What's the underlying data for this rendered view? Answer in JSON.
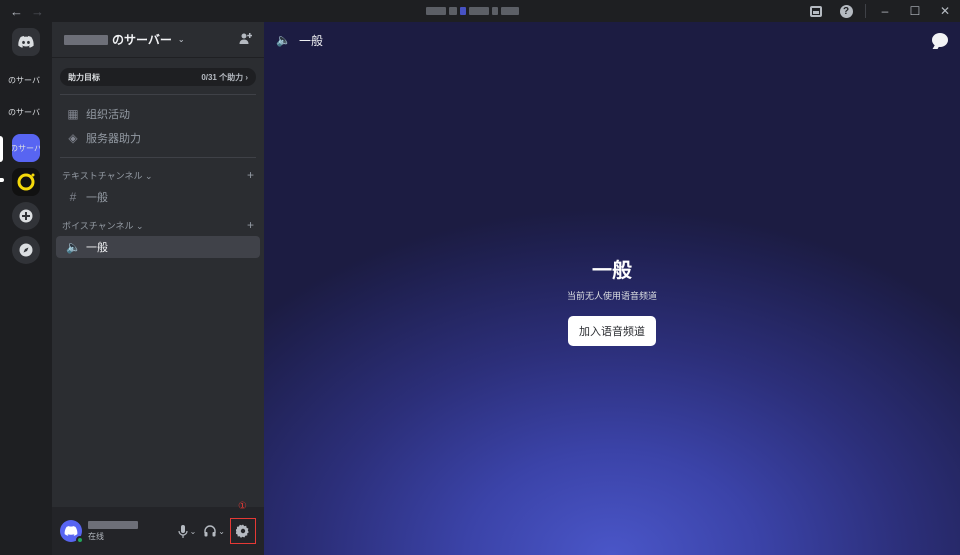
{
  "titlebar": {
    "back": "←",
    "forward": "→",
    "help": "?",
    "minimize": "–",
    "maximize": "☐",
    "close": "✕"
  },
  "rail": {
    "servers": [
      {
        "label": "Discord"
      },
      {
        "label": "のサーバ"
      },
      {
        "label": "のサーバ"
      },
      {
        "label": "のサーバ"
      },
      {
        "label": "O"
      },
      {
        "label": "+"
      },
      {
        "label": "Explore"
      }
    ]
  },
  "sidebar": {
    "guild_name": "のサーバー",
    "boost_goal_label": "助力目标",
    "boost_goal_count": "0/31 个助力 ›",
    "events_label": "组织活动",
    "server_boost_label": "服务器助力",
    "text_category": "テキストチャンネル ⌄",
    "text_channel": "一般",
    "voice_category": "ボイスチャンネル ⌄",
    "voice_channel": "一般"
  },
  "user_panel": {
    "status_text": "在线",
    "callout_number": "①"
  },
  "main": {
    "header_title": "一般",
    "voice_title": "一般",
    "voice_subtitle": "当前无人使用语音频道",
    "join_button": "加入语音频道"
  },
  "colors": {
    "accent": "#5865f2",
    "online": "#23a55a",
    "highlight_box": "#e53935"
  }
}
